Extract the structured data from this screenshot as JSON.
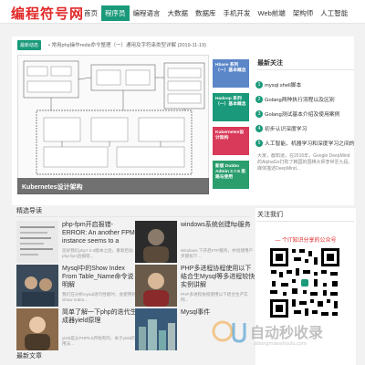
{
  "site": {
    "logo": "编程符号网"
  },
  "nav": {
    "items": [
      {
        "label": "首页",
        "active": false
      },
      {
        "label": "程序员",
        "active": true
      },
      {
        "label": "编程语言",
        "active": false
      },
      {
        "label": "大数据",
        "active": false
      },
      {
        "label": "数据库",
        "active": false
      },
      {
        "label": "手机开发",
        "active": false
      },
      {
        "label": "Web前端",
        "active": false
      },
      {
        "label": "架构师",
        "active": false
      },
      {
        "label": "人工智能",
        "active": false
      }
    ]
  },
  "notice": {
    "badge": "最新动态",
    "text": "• 常用php操作redis命令整理（一）通用及字符串类型详解 (2019-11-19)"
  },
  "hero": {
    "caption": "Kubernetes设计架构"
  },
  "side_cards": [
    {
      "label": "Hbase 系列（一）基本概念",
      "color": "#5b86c8"
    },
    {
      "label": "Hadoop 系列（一）基本概念",
      "color": "#1a9a7a"
    },
    {
      "label": "Kubernetes设计架构",
      "color": "#d93a5a"
    },
    {
      "label": "新版 Dubbo Admin 2.7.6 思路与使用",
      "color": "#2b9e6e"
    }
  ],
  "hot": {
    "title": "最新关注",
    "items": [
      {
        "num": "1",
        "text": "mysql shell脚本"
      },
      {
        "num": "2",
        "text": "Golang两种执行流程以及区别"
      },
      {
        "num": "3",
        "text": "Golang测试基本介绍及使用案例"
      },
      {
        "num": "4",
        "text": "初步认识深度学习"
      },
      {
        "num": "5",
        "text": "人工智能、机器学习和深度学习之间的"
      }
    ],
    "snippet": "大家，都知道，在2016年，Google DeepMind的AlphaGo打败了韩国的围棋大师李世乭九段。媒体描述DeepMind..."
  },
  "featured": {
    "title": "精选导读"
  },
  "posts": [
    {
      "title": "php-fpm开启报错-ERROR: An another FPM instance seems to a",
      "desc": "您好我们php7.0.0版本之后，重新启动php-fpm后报错..."
    },
    {
      "title": "windows系统创建ftp服务",
      "desc": "Windows 下开启FTP服务，并创建用户 步骤如下..."
    },
    {
      "title": "Mysql中的Show Index From Table_Name命令说明解",
      "desc": "我们在分析mysql语句性能时，会使用到Show Index..."
    },
    {
      "title": "PHP多进程协程使用以下结合生Mysql等多进程较快实例讲解",
      "desc": "PHP多进程协程使用以下结合生产实例..."
    },
    {
      "title": "简单了解一下php的迭代生成器yield原理",
      "desc": "yield是从PHP5.5开始有的，关于yield的用法..."
    },
    {
      "title": "Mysql事件",
      "desc": ""
    }
  ],
  "follow": {
    "title": "关注我们",
    "subtitle": "— 个IT知识分享的公众号"
  },
  "watermark": {
    "text": "自动秒收录",
    "sub": "zidongmiaoshoulu.com"
  },
  "latest": {
    "title": "最新文章"
  },
  "colors": {
    "accent": "#1a9a7a",
    "brand": "#e02828"
  }
}
